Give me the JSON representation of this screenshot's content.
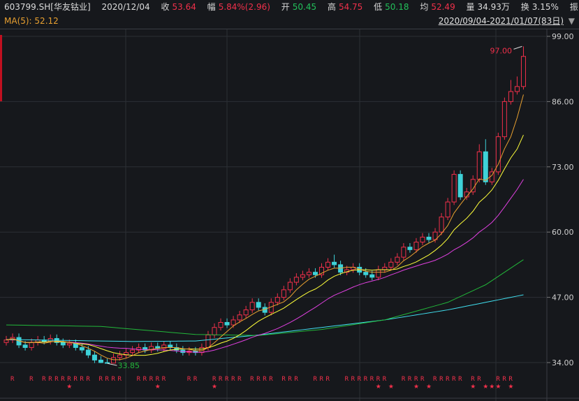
{
  "header": {
    "symbol": "603799.SH[华友钴业]",
    "date": "2020/12/04",
    "close_label": "收",
    "close": "53.64",
    "change_label": "幅",
    "change": "5.84%(2.96)",
    "open_label": "开",
    "open": "50.45",
    "high_label": "高",
    "high": "54.75",
    "low_label": "低",
    "low": "50.18",
    "avg_label": "均",
    "avg": "52.49",
    "vol_label": "量",
    "vol": "34.93万",
    "turnover_label": "换",
    "turnover": "3.15%",
    "amp_label": "振"
  },
  "ma_label": "MA(5): 52.12",
  "range_label": "2020/09/04-2021/01/07(83日)",
  "colors": {
    "up": "#f0304a",
    "down": "#3ed2d8",
    "ma5": "#e8a030",
    "ma10": "#ffff3a",
    "ma20": "#e040e0",
    "ma60": "#22b83a",
    "ma120": "#40e0f0",
    "bg": "#16181c",
    "grid": "#3a3d44"
  },
  "chart_data": {
    "type": "candlestick",
    "y_ticks": [
      "99.00",
      "86.00",
      "73.00",
      "60.00",
      "47.00",
      "34.00"
    ],
    "ylim": [
      34,
      99
    ],
    "max_annotation": "97.00",
    "min_annotation": "33.85",
    "open": [
      38.0,
      38.5,
      39.0,
      37.5,
      37.0,
      38.0,
      38.5,
      38.2,
      38.8,
      38.0,
      37.5,
      37.8,
      37.0,
      36.5,
      35.5,
      34.5,
      34.0,
      33.9,
      35.0,
      35.5,
      36.0,
      36.5,
      37.0,
      36.5,
      37.2,
      36.8,
      37.5,
      37.0,
      36.5,
      36.0,
      36.3,
      36.0,
      37.0,
      39.5,
      41.0,
      42.0,
      41.5,
      42.5,
      43.5,
      44.5,
      46.0,
      45.0,
      44.0,
      46.0,
      47.0,
      48.5,
      50.0,
      51.0,
      51.5,
      52.0,
      51.5,
      53.0,
      54.0,
      53.5,
      52.0,
      52.5,
      53.0,
      52.0,
      51.5,
      51.0,
      52.5,
      53.0,
      54.0,
      55.0,
      57.0,
      56.5,
      58.0,
      59.0,
      58.5,
      60.0,
      63.0,
      66.0,
      71.5,
      67.0,
      68.0,
      70.5,
      76.0,
      70.0,
      72.0,
      79.0,
      86.0,
      88.0,
      89.0
    ],
    "high": [
      39.3,
      39.8,
      39.8,
      38.3,
      38.8,
      39.3,
      39.3,
      39.6,
      39.6,
      38.8,
      38.6,
      38.6,
      37.8,
      37.3,
      36.3,
      35.3,
      34.8,
      35.8,
      36.3,
      36.8,
      37.3,
      37.8,
      37.8,
      38.0,
      38.0,
      38.3,
      38.3,
      37.8,
      37.3,
      37.1,
      37.1,
      37.8,
      40.3,
      41.8,
      42.8,
      42.8,
      43.3,
      44.3,
      45.3,
      46.8,
      46.8,
      45.8,
      46.8,
      47.8,
      49.3,
      50.8,
      51.8,
      52.3,
      52.8,
      52.8,
      53.8,
      54.8,
      55.5,
      54.3,
      53.3,
      53.8,
      53.8,
      52.8,
      52.3,
      53.3,
      53.8,
      54.8,
      55.8,
      57.8,
      57.8,
      58.8,
      59.8,
      59.8,
      60.8,
      63.8,
      66.8,
      72.3,
      72.3,
      68.8,
      71.3,
      77.5,
      78.5,
      72.8,
      79.8,
      86.8,
      90.3,
      91.0,
      97.0
    ],
    "low": [
      37.4,
      37.9,
      36.9,
      36.4,
      36.4,
      37.4,
      37.6,
      37.6,
      37.4,
      36.9,
      36.9,
      36.4,
      35.9,
      34.9,
      33.9,
      33.9,
      33.85,
      33.9,
      34.4,
      34.9,
      35.4,
      35.9,
      35.9,
      35.9,
      36.2,
      36.2,
      36.4,
      35.9,
      35.4,
      35.4,
      35.4,
      35.4,
      36.4,
      38.9,
      40.4,
      40.9,
      40.9,
      41.9,
      42.9,
      43.9,
      44.4,
      43.4,
      43.4,
      45.4,
      46.4,
      47.9,
      49.4,
      50.4,
      50.9,
      50.9,
      50.9,
      52.4,
      52.9,
      51.4,
      51.4,
      51.9,
      51.4,
      50.9,
      50.4,
      50.4,
      51.9,
      52.4,
      53.4,
      54.4,
      55.9,
      55.9,
      57.4,
      57.9,
      57.9,
      59.4,
      62.4,
      65.4,
      66.4,
      66.4,
      67.4,
      69.9,
      69.4,
      69.4,
      71.4,
      78.4,
      85.4,
      87.4,
      88.4
    ],
    "close": [
      38.5,
      39.0,
      37.5,
      37.0,
      38.0,
      38.5,
      38.2,
      38.8,
      38.0,
      37.5,
      37.8,
      37.0,
      36.5,
      35.5,
      34.5,
      34.0,
      33.9,
      35.0,
      35.5,
      36.0,
      36.5,
      37.0,
      36.5,
      37.2,
      36.8,
      37.5,
      37.0,
      36.5,
      36.0,
      36.3,
      36.0,
      37.0,
      39.5,
      41.0,
      42.0,
      41.5,
      42.5,
      43.5,
      44.5,
      46.0,
      45.0,
      44.0,
      46.0,
      47.0,
      48.5,
      50.0,
      51.0,
      51.5,
      52.0,
      51.5,
      53.0,
      54.0,
      53.5,
      52.0,
      52.5,
      53.0,
      52.0,
      51.5,
      51.0,
      52.5,
      53.0,
      54.0,
      55.0,
      57.0,
      56.5,
      58.0,
      59.0,
      58.5,
      60.0,
      63.0,
      66.0,
      71.5,
      67.0,
      68.0,
      70.5,
      76.0,
      70.0,
      72.0,
      79.0,
      86.0,
      88.0,
      89.0,
      95.0
    ],
    "ma60_samples": [
      [
        0,
        41.5
      ],
      [
        15,
        41.2
      ],
      [
        30,
        39.6
      ],
      [
        40,
        39.4
      ],
      [
        50,
        40.6
      ],
      [
        60,
        42.5
      ],
      [
        70,
        46.0
      ],
      [
        76,
        49.5
      ],
      [
        82,
        54.5
      ]
    ],
    "ma120_samples": [
      [
        0,
        38.6
      ],
      [
        20,
        38.2
      ],
      [
        30,
        38.3
      ],
      [
        40,
        39.5
      ],
      [
        50,
        41.0
      ],
      [
        60,
        42.5
      ],
      [
        70,
        44.5
      ],
      [
        82,
        47.5
      ]
    ],
    "r_mark": "R",
    "star_mark": "★",
    "r_marks": [
      1,
      4,
      6,
      7,
      8,
      9,
      10,
      11,
      12,
      13,
      15,
      16,
      17,
      18,
      21,
      22,
      23,
      24,
      25,
      29,
      30,
      33,
      34,
      35,
      36,
      37,
      39,
      40,
      41,
      42,
      44,
      45,
      46,
      49,
      50,
      51,
      54,
      55,
      56,
      57,
      58,
      59,
      60,
      63,
      64,
      65,
      66,
      68,
      69,
      70,
      71,
      72,
      74,
      75,
      78,
      79,
      80
    ],
    "star_marks": [
      10,
      24,
      33,
      59,
      61,
      65,
      67,
      74,
      76,
      77,
      78,
      80
    ]
  }
}
